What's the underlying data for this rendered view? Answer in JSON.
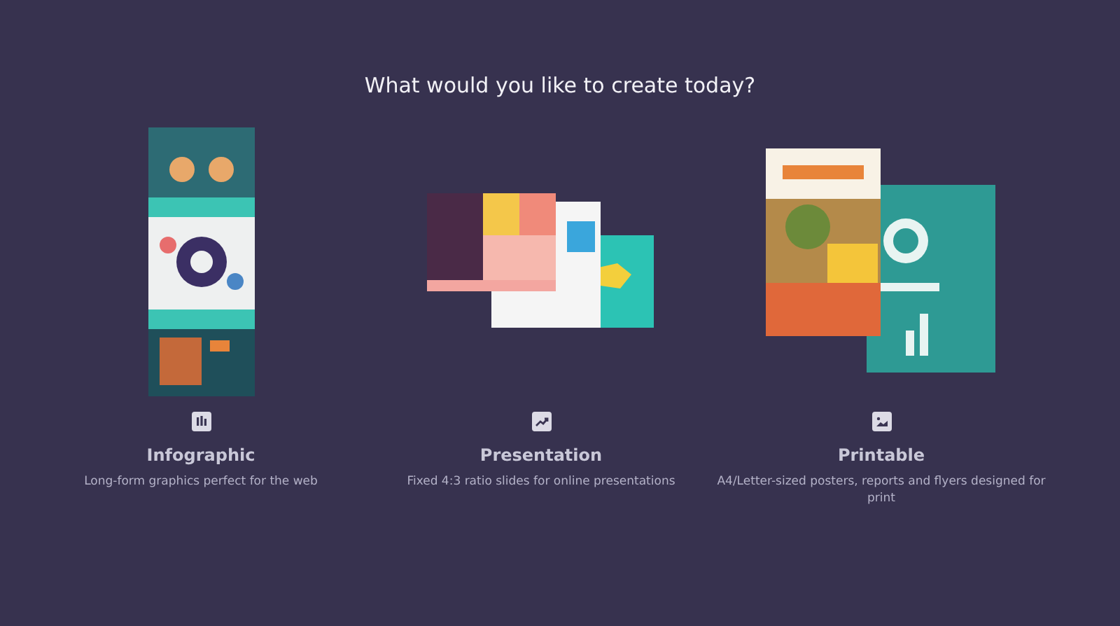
{
  "heading": "What would you like to create today?",
  "options": [
    {
      "title": "Infographic",
      "description": "Long-form graphics perfect for the web"
    },
    {
      "title": "Presentation",
      "description": "Fixed 4:3 ratio slides for online presentations"
    },
    {
      "title": "Printable",
      "description": "A4/Letter-sized posters, reports and flyers designed for print"
    }
  ]
}
